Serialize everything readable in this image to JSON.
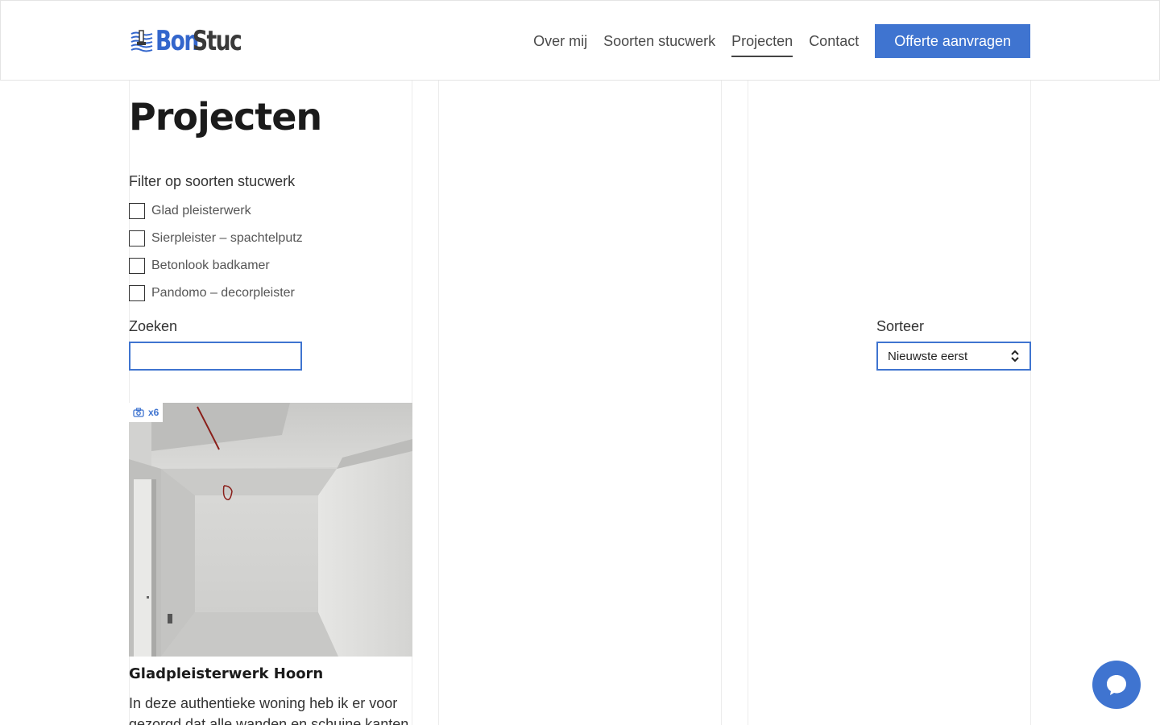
{
  "brand": {
    "name_part1": "Bon",
    "name_part2": "Stuc",
    "accent": "#3f74d0"
  },
  "nav": {
    "items": [
      {
        "label": "Over mij",
        "active": false
      },
      {
        "label": "Soorten stucwerk",
        "active": false
      },
      {
        "label": "Projecten",
        "active": true
      },
      {
        "label": "Contact",
        "active": false
      }
    ],
    "cta_label": "Offerte aanvragen"
  },
  "page": {
    "title": "Projecten"
  },
  "filters": {
    "label": "Filter op soorten stucwerk",
    "options": [
      {
        "label": "Glad pleisterwerk",
        "checked": false
      },
      {
        "label": "Sierpleister – spachtelputz",
        "checked": false
      },
      {
        "label": "Betonlook badkamer",
        "checked": false
      },
      {
        "label": "Pandomo – decorpleister",
        "checked": false
      }
    ]
  },
  "search": {
    "label": "Zoeken",
    "value": "",
    "placeholder": ""
  },
  "sort": {
    "label": "Sorteer",
    "selected": "Nieuwste eerst"
  },
  "projects": [
    {
      "photo_count": "x6",
      "title": "Gladpleisterwerk Hoorn",
      "description": "In deze authentieke woning heb ik er voor gezorgd dat alle wanden en schuine kanten"
    }
  ],
  "icons": {
    "photo": "camera-icon",
    "chat": "chat-icon",
    "sort": "sort-arrows-icon"
  }
}
